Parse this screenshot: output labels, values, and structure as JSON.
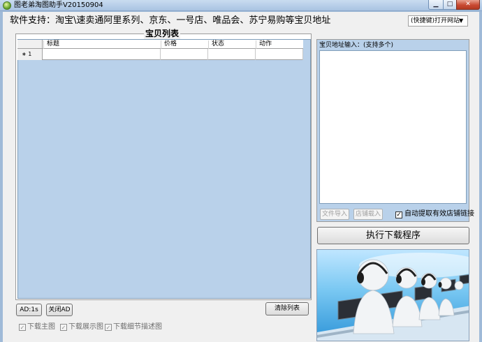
{
  "window": {
    "title": "图老弟淘图助手V20150904",
    "min_glyph": "▁",
    "max_glyph": "□",
    "close_glyph": "✕"
  },
  "header": {
    "support_text": "软件支持：淘宝\\速卖通阿里系列、京东、一号店、唯品会、苏宁易购等宝贝地址",
    "open_site_value": "(快捷键)打开网站",
    "open_site_arrow": "▼"
  },
  "list_panel": {
    "title": "宝贝列表",
    "columns": [
      "标题",
      "价格",
      "状态",
      "动作"
    ],
    "rows": [
      {
        "marker": "∗",
        "index": "1",
        "title": "",
        "price": "",
        "status": "",
        "action": ""
      }
    ]
  },
  "bottom_left": {
    "ad_button": "AD:1s",
    "close_ad_button": "关闭AD",
    "clear_button": "清除列表",
    "checkboxes": [
      {
        "label": "下载主图",
        "checked": true
      },
      {
        "label": "下载展示图",
        "checked": true
      },
      {
        "label": "下载细节描述图",
        "checked": true
      }
    ]
  },
  "right_panel": {
    "url_label": "宝贝地址输入：(支持多个)",
    "url_value": "",
    "import_file_button": "文件导入",
    "shop_import_button": "店铺载入",
    "auto_extract_label": "自动提取有效店铺链接",
    "auto_extract_checked": true,
    "execute_button": "执行下载程序"
  },
  "colors": {
    "grid_bg": "#b9d1ea",
    "promo_bg": "#2f95d8"
  }
}
